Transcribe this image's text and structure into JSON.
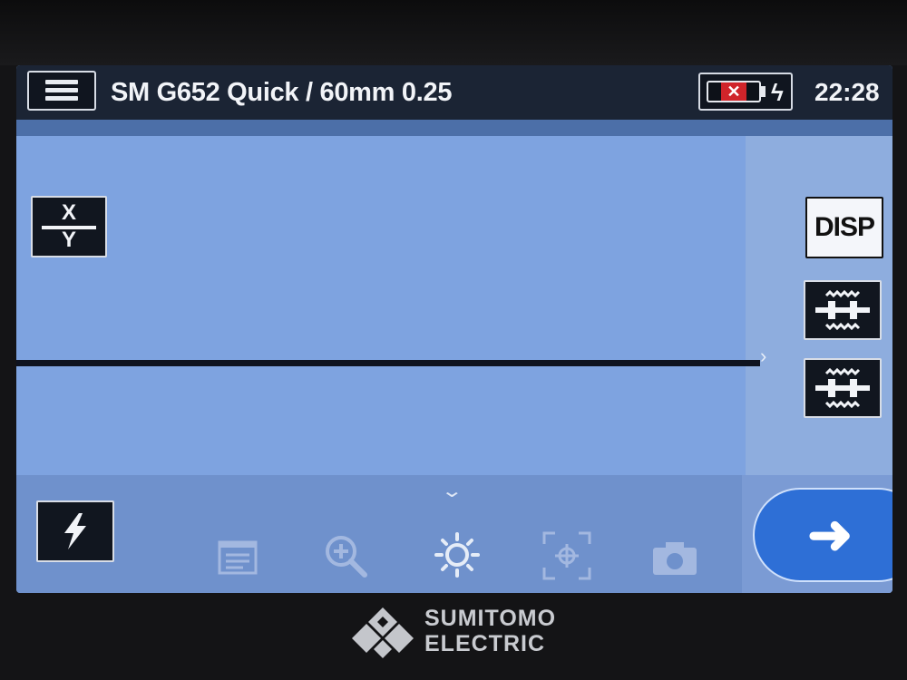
{
  "topbar": {
    "title": "SM G652 Quick / 60mm 0.25",
    "clock": "22:28",
    "battery_state": "empty-charging"
  },
  "left_buttons": {
    "xy": {
      "top": "X",
      "bottom": "Y"
    }
  },
  "right_buttons": {
    "disp": "DISP"
  },
  "toolbar": {
    "icons": [
      "notes-icon",
      "zoom-in-icon",
      "brightness-icon",
      "focus-icon",
      "camera-icon"
    ]
  },
  "brand": {
    "line1": "SUMITOMO",
    "line2": "ELECTRIC"
  },
  "colors": {
    "screen": "#7ea3e0",
    "topbar": "#1b2434",
    "accent": "#2e6fd6",
    "battery_alert": "#d0242a"
  }
}
